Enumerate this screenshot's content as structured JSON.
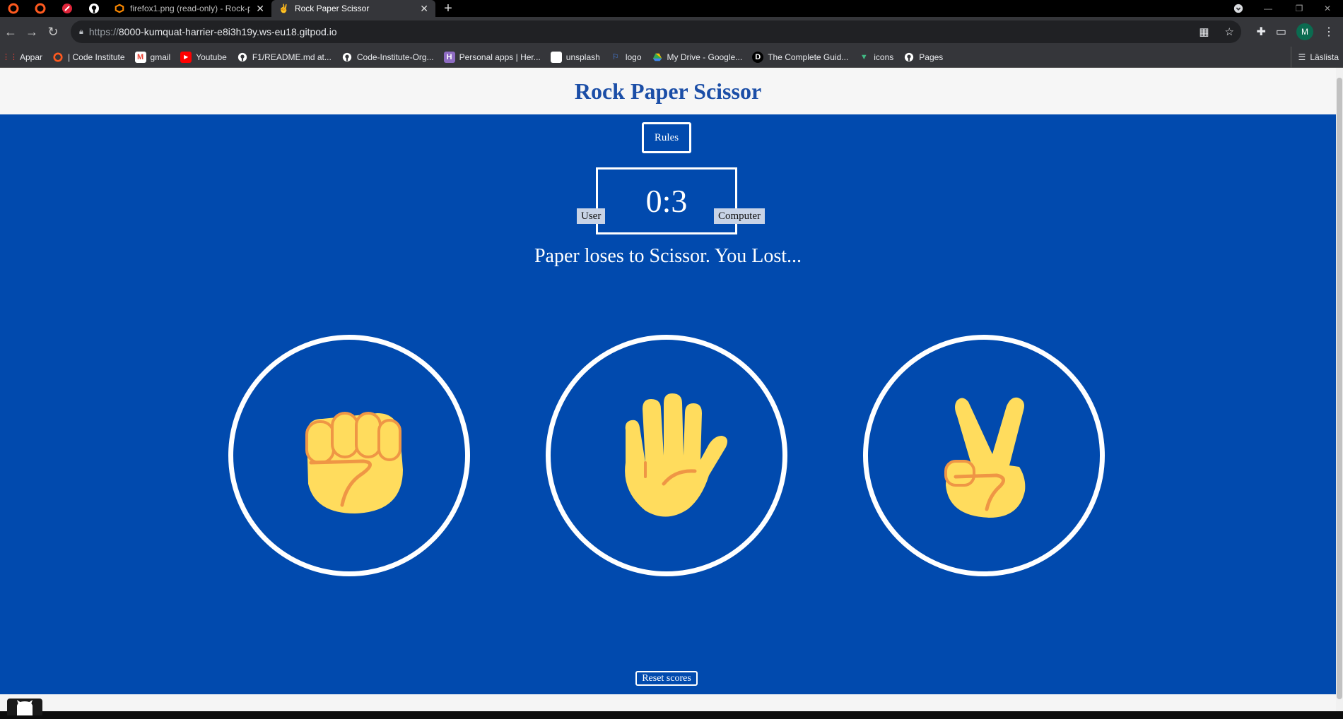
{
  "browser": {
    "tabs": [
      {
        "title": "firefox1.png (read-only) - Rock-p"
      },
      {
        "title": "Rock Paper Scissor"
      }
    ],
    "url_scheme": "https://",
    "url_host": "8000-kumquat-harrier-e8i3h19y.ws-eu18.gitpod.io",
    "profile_initial": "M",
    "bookmarks": [
      {
        "label": "Appar",
        "icon": "apps-grid-icon",
        "color": "#f44336"
      },
      {
        "label": "| Code Institute",
        "icon": "code-institute-icon",
        "color": "#ff5a1f"
      },
      {
        "label": "gmail",
        "icon": "gmail-icon",
        "color": "#ea4335"
      },
      {
        "label": "Youtube",
        "icon": "youtube-icon",
        "color": "#ff0000"
      },
      {
        "label": "F1/README.md at...",
        "icon": "github-icon",
        "color": "#ffffff"
      },
      {
        "label": "Code-Institute-Org...",
        "icon": "github-icon",
        "color": "#ffffff"
      },
      {
        "label": "Personal apps | Her...",
        "icon": "heroku-icon",
        "color": "#8e6bc2"
      },
      {
        "label": "unsplash",
        "icon": "unsplash-icon",
        "color": "#ffffff"
      },
      {
        "label": "logo",
        "icon": "flag-icon",
        "color": "#4a8cff"
      },
      {
        "label": "My Drive - Google...",
        "icon": "google-drive-icon",
        "color": "#34a853"
      },
      {
        "label": "The Complete Guid...",
        "icon": "d-logo-icon",
        "color": "#ffffff"
      },
      {
        "label": "icons",
        "icon": "vue-icon",
        "color": "#41b883"
      },
      {
        "label": "Pages",
        "icon": "github-icon",
        "color": "#ffffff"
      }
    ],
    "reading_list": "Läslista"
  },
  "page": {
    "title": "Rock Paper Scissor",
    "rules_label": "Rules",
    "score": "0:3",
    "user_label": "User",
    "computer_label": "Computer",
    "result_text": "Paper loses to Scissor. You Lost...",
    "choices": [
      {
        "name": "rock",
        "icon": "fist-icon"
      },
      {
        "name": "paper",
        "icon": "raised-hand-icon"
      },
      {
        "name": "scissor",
        "icon": "victory-hand-icon"
      }
    ],
    "reset_label": "Reset scores"
  },
  "colors": {
    "game_background": "#014aae",
    "title_color": "#1b4ea7",
    "hand_fill": "#ffdc5d",
    "hand_stroke": "#ef9645"
  }
}
